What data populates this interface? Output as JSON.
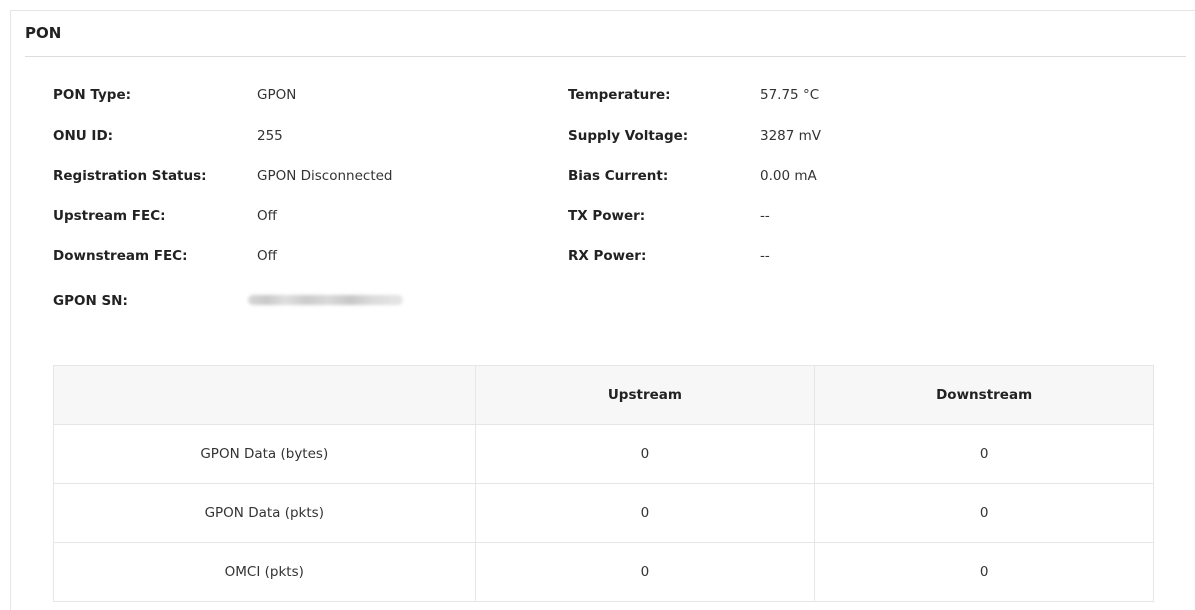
{
  "panel": {
    "title": "PON"
  },
  "left_fields": [
    {
      "label": "PON Type:",
      "value": "GPON"
    },
    {
      "label": "ONU ID:",
      "value": "255"
    },
    {
      "label": "Registration Status:",
      "value": "GPON Disconnected"
    },
    {
      "label": "Upstream FEC:",
      "value": "Off"
    },
    {
      "label": "Downstream FEC:",
      "value": "Off"
    },
    {
      "label": "GPON SN:",
      "value": ""
    }
  ],
  "right_fields": [
    {
      "label": "Temperature:",
      "value": "57.75 °C"
    },
    {
      "label": "Supply Voltage:",
      "value": "3287 mV"
    },
    {
      "label": "Bias Current:",
      "value": "0.00 mA"
    },
    {
      "label": "TX Power:",
      "value": "--"
    },
    {
      "label": "RX Power:",
      "value": "--"
    }
  ],
  "stats_table": {
    "headers": [
      "",
      "Upstream",
      "Downstream"
    ],
    "rows": [
      {
        "name": "GPON Data (bytes)",
        "upstream": "0",
        "downstream": "0"
      },
      {
        "name": "GPON Data (pkts)",
        "upstream": "0",
        "downstream": "0"
      },
      {
        "name": "OMCI (pkts)",
        "upstream": "0",
        "downstream": "0"
      }
    ]
  }
}
